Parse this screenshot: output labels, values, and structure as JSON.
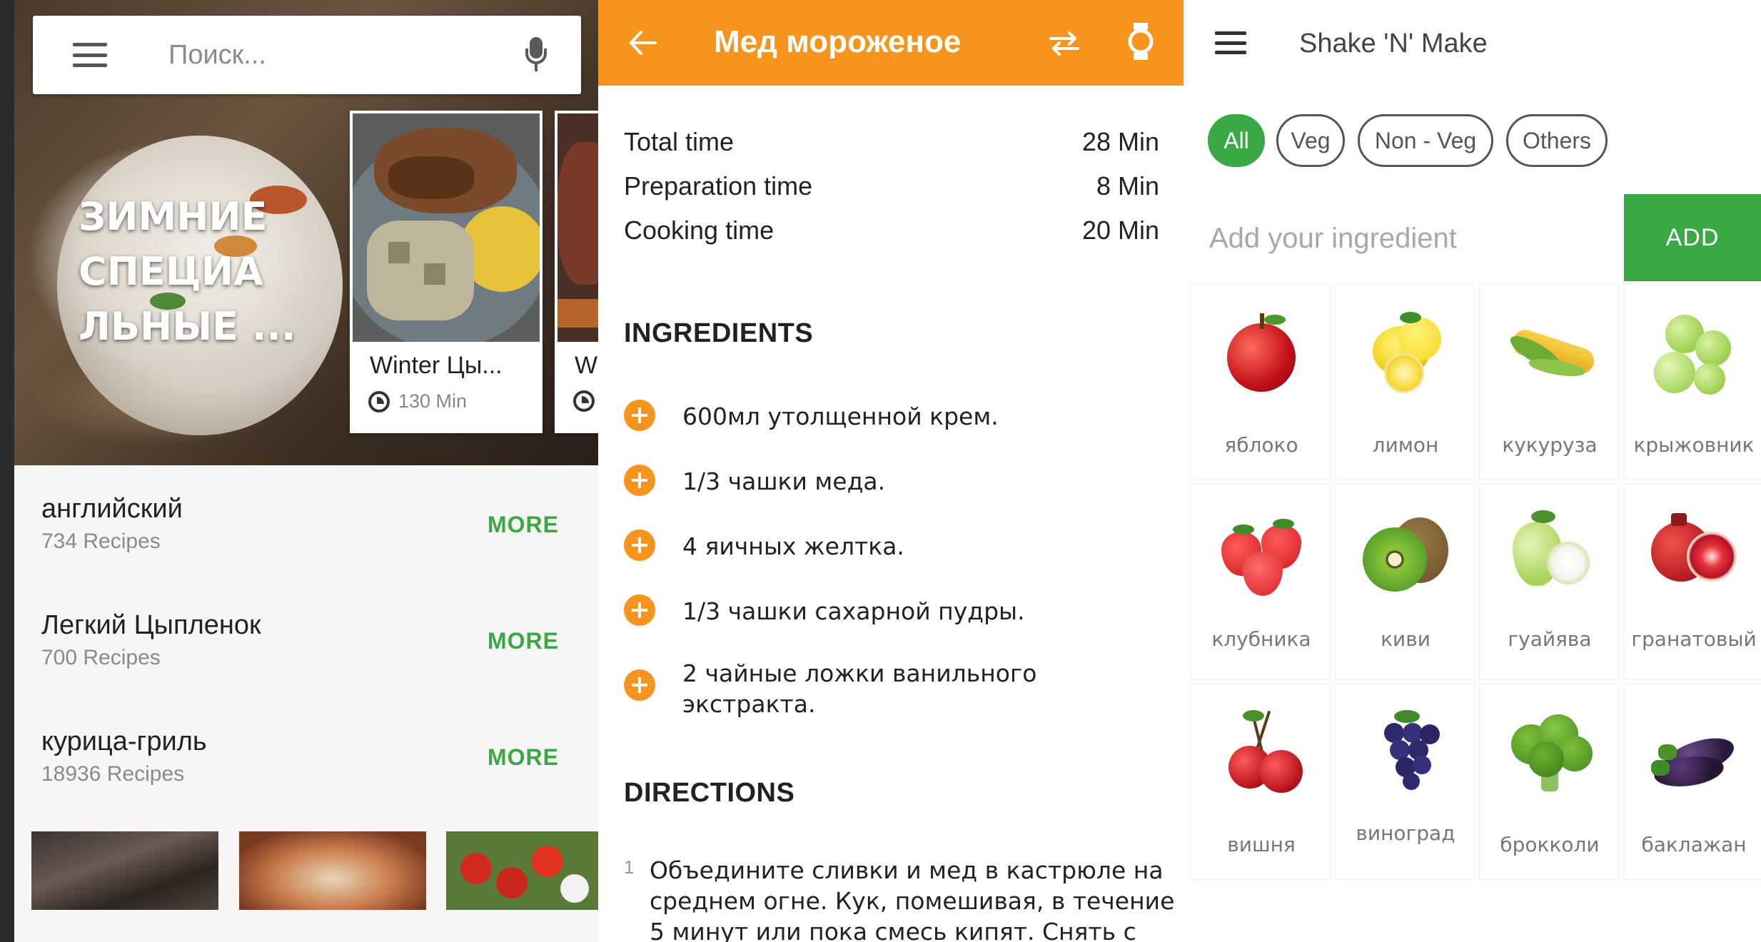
{
  "screen1": {
    "search": {
      "placeholder": "Поиск..."
    },
    "hero": {
      "title": "ЗИМНИЕ СПЕЦИА ЛЬНЫЕ ..."
    },
    "cards": [
      {
        "title": "Winter Цы...",
        "time": "130 Min"
      },
      {
        "title": "W",
        "time": ""
      }
    ],
    "categories": [
      {
        "name": "английский",
        "count": "734 Recipes",
        "more": "MORE"
      },
      {
        "name": "Легкий Цыпленок",
        "count": "700 Recipes",
        "more": "MORE"
      },
      {
        "name": "курица-гриль",
        "count": "18936 Recipes",
        "more": "MORE"
      }
    ],
    "colors": {
      "accent": "#3aa845",
      "background": "#f7f6f5"
    }
  },
  "screen2": {
    "header": {
      "title": "Мед мороженое",
      "back_icon": "arrow-left-icon",
      "swap_icon": "swap-arrows-icon",
      "watch_icon": "smartwatch-icon"
    },
    "times": [
      {
        "label": "Total time",
        "value": "28 Min"
      },
      {
        "label": "Preparation time",
        "value": "8 Min"
      },
      {
        "label": "Cooking time",
        "value": "20 Min"
      }
    ],
    "ingredients_heading": "INGREDIENTS",
    "ingredients": [
      "600мл утолщенной крем.",
      "1/3 чашки меда.",
      "4 яичных желтка.",
      "1/3 чашки сахарной пудры.",
      "2 чайные ложки ванильного экстракта."
    ],
    "directions_heading": "DIRECTIONS",
    "directions": [
      {
        "num": "1",
        "text": "Объедините сливки и мед в кастрюле на среднем огне. Кук, помешивая, в течение 5 минут или пока смесь кипят. Снять с"
      }
    ],
    "colors": {
      "header": "#f7941d",
      "plus": "#f7941d"
    }
  },
  "screen3": {
    "header": {
      "title": "Shake 'N' Make",
      "menu_icon": "hamburger-menu-icon"
    },
    "filters": [
      "All",
      "Veg",
      "Non - Veg",
      "Others"
    ],
    "active_filter": "All",
    "ingredient_input": {
      "placeholder": "Add your ingredient"
    },
    "add_button": "ADD",
    "items": [
      {
        "label": "яблоко",
        "icon": "apple-icon"
      },
      {
        "label": "лимон",
        "icon": "lemon-icon"
      },
      {
        "label": "кукуруза",
        "icon": "corn-icon"
      },
      {
        "label": "крыжовник",
        "icon": "gooseberry-icon"
      },
      {
        "label": "клубника",
        "icon": "strawberry-icon"
      },
      {
        "label": "киви",
        "icon": "kiwi-icon"
      },
      {
        "label": "гуайява",
        "icon": "guava-icon"
      },
      {
        "label": "гранатовый",
        "icon": "pomegranate-icon"
      },
      {
        "label": "вишня",
        "icon": "cherry-icon"
      },
      {
        "label": "виноград",
        "icon": "grape-icon"
      },
      {
        "label": "брокколи",
        "icon": "broccoli-icon"
      },
      {
        "label": "баклажан",
        "icon": "eggplant-icon"
      }
    ],
    "colors": {
      "accent": "#3aa845"
    }
  }
}
